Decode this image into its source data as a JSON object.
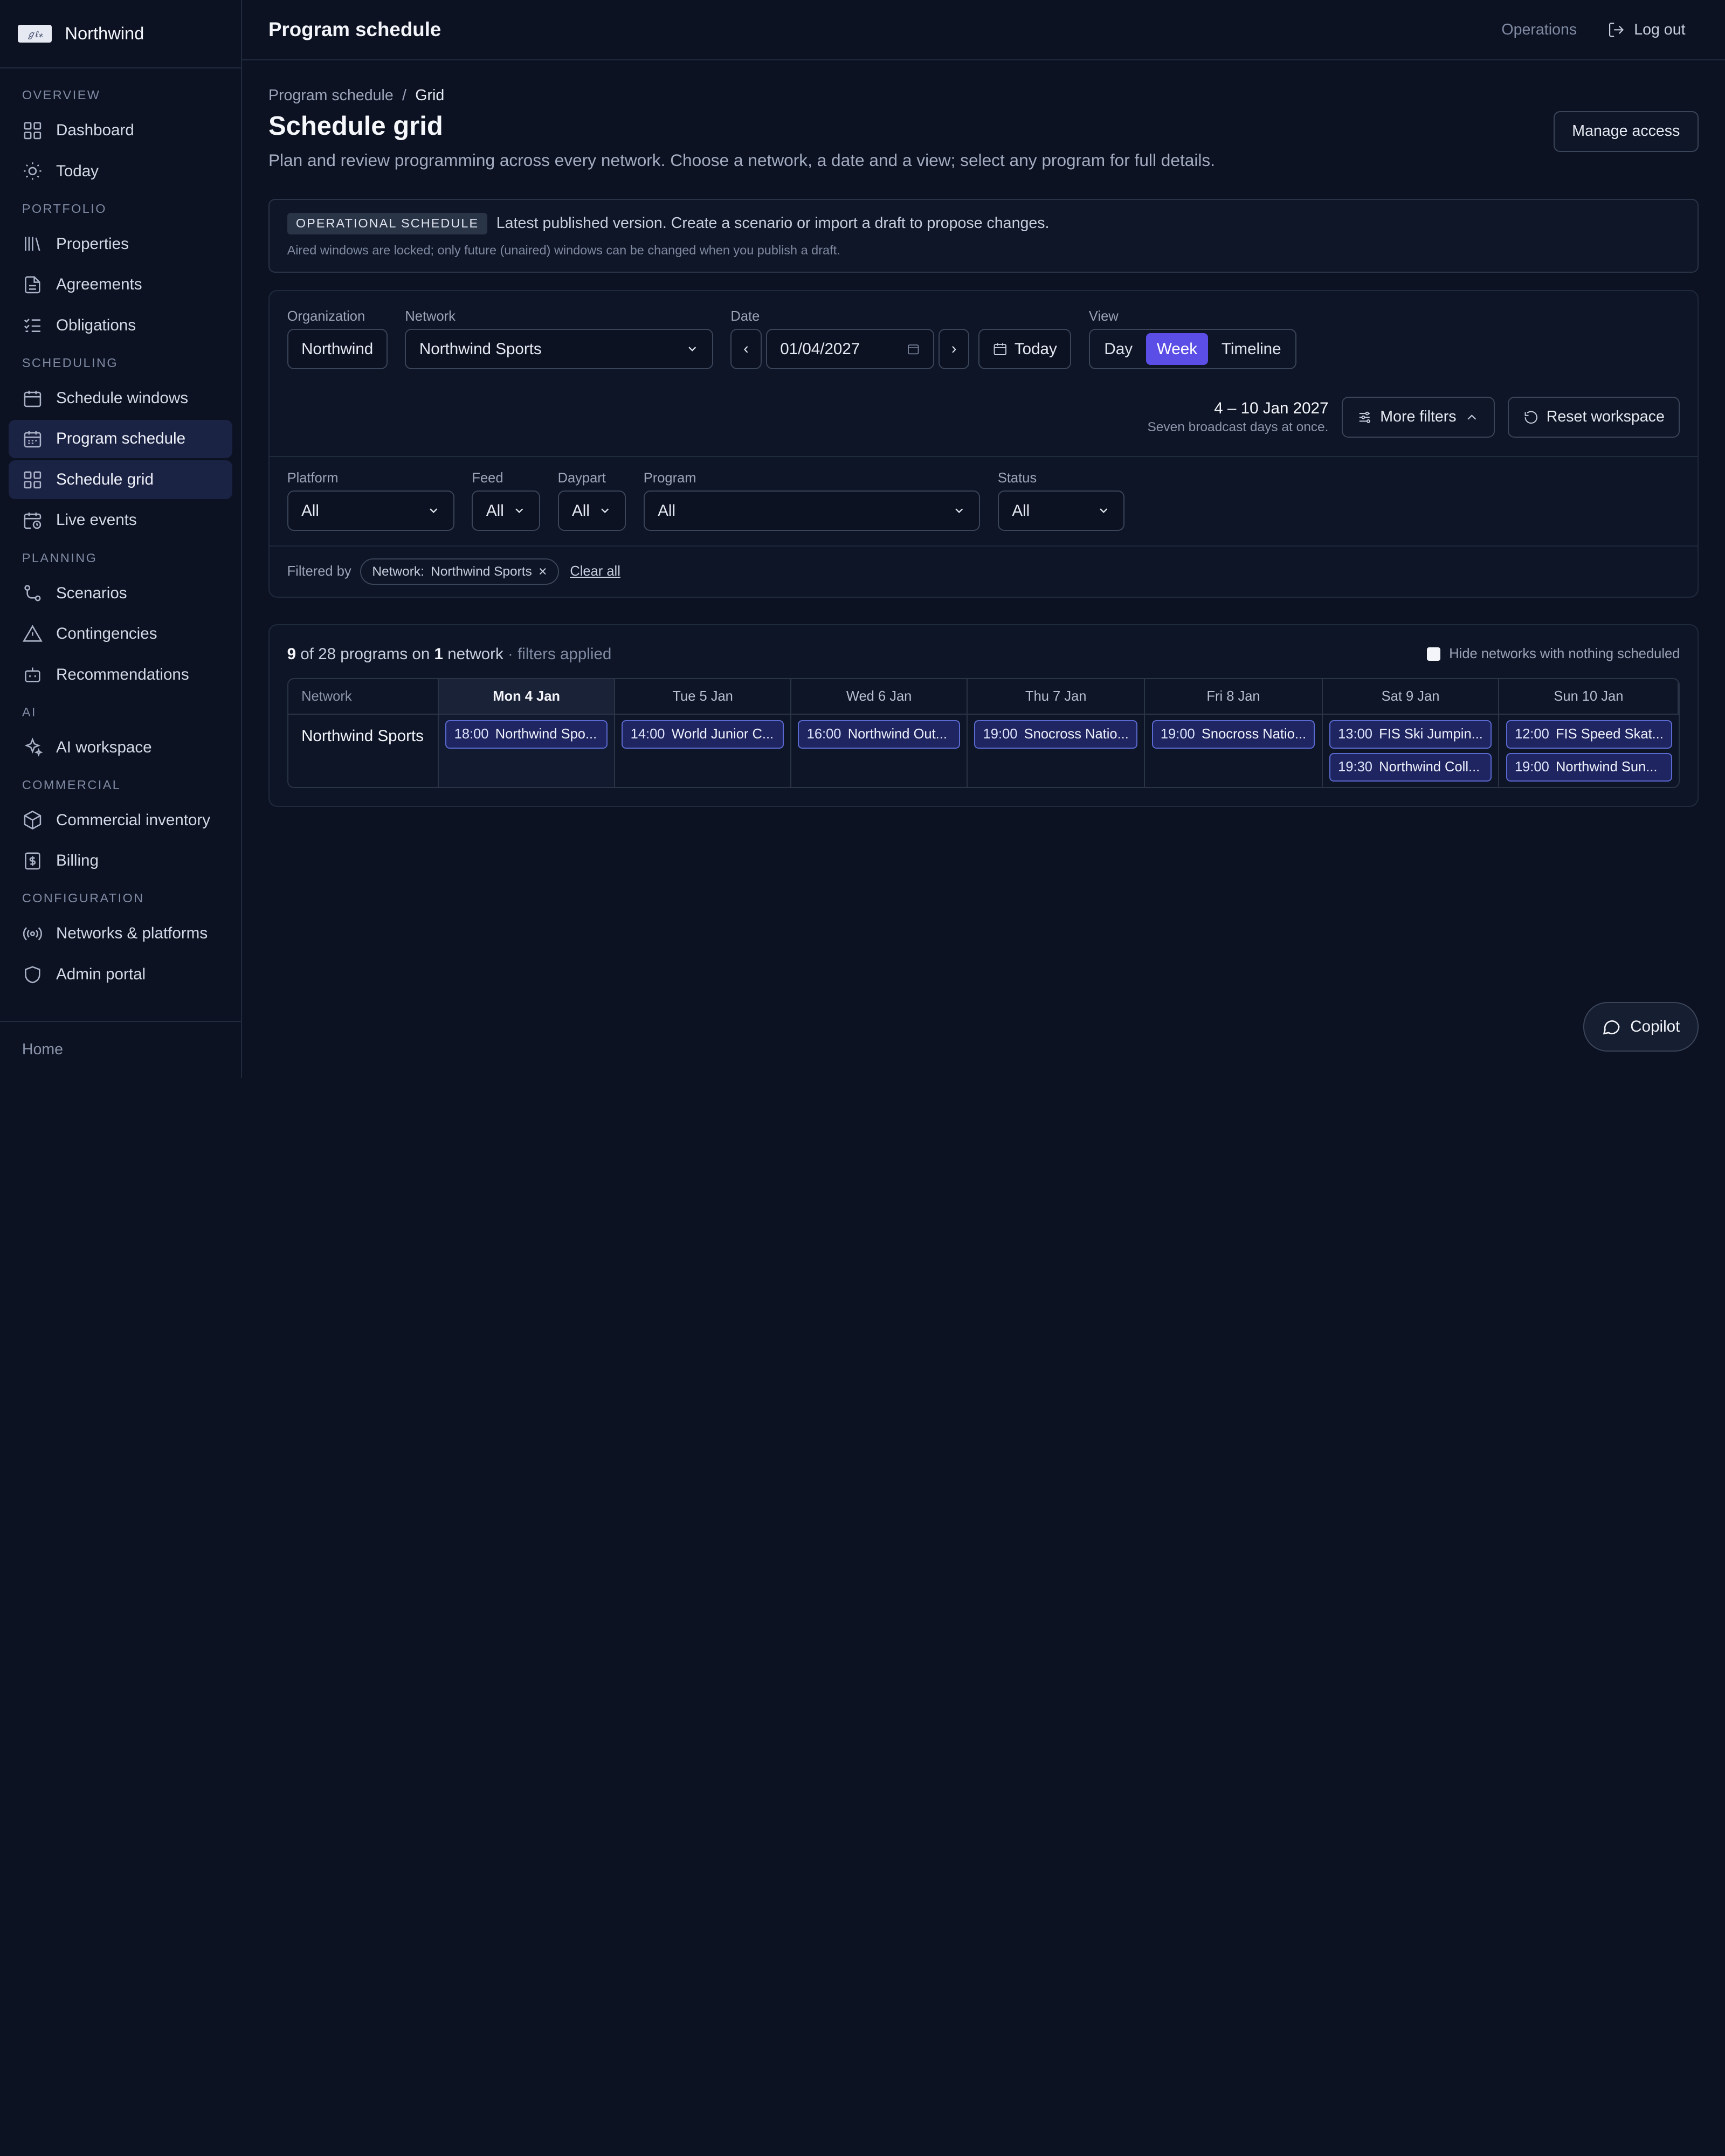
{
  "brand": {
    "name": "Northwind",
    "logo_text": "ℊℓ⁎"
  },
  "sidebar": {
    "sections": [
      {
        "title": "OVERVIEW",
        "items": [
          {
            "label": "Dashboard",
            "icon": "grid-icon"
          },
          {
            "label": "Today",
            "icon": "sun-icon"
          }
        ]
      },
      {
        "title": "PORTFOLIO",
        "items": [
          {
            "label": "Properties",
            "icon": "library-icon"
          },
          {
            "label": "Agreements",
            "icon": "file-icon"
          },
          {
            "label": "Obligations",
            "icon": "checklist-icon"
          }
        ]
      },
      {
        "title": "SCHEDULING",
        "items": [
          {
            "label": "Schedule windows",
            "icon": "calendar-icon"
          },
          {
            "label": "Program schedule",
            "icon": "calendar-grid-icon",
            "active": true
          },
          {
            "label": "Schedule grid",
            "icon": "grid-icon",
            "active": true
          },
          {
            "label": "Live events",
            "icon": "calendar-clock-icon"
          }
        ]
      },
      {
        "title": "PLANNING",
        "items": [
          {
            "label": "Scenarios",
            "icon": "branch-icon"
          },
          {
            "label": "Contingencies",
            "icon": "warning-icon"
          },
          {
            "label": "Recommendations",
            "icon": "bot-icon"
          }
        ]
      },
      {
        "title": "AI",
        "items": [
          {
            "label": "AI workspace",
            "icon": "sparkles-icon"
          }
        ]
      },
      {
        "title": "COMMERCIAL",
        "items": [
          {
            "label": "Commercial inventory",
            "icon": "box-icon"
          },
          {
            "label": "Billing",
            "icon": "dollar-icon"
          }
        ]
      },
      {
        "title": "CONFIGURATION",
        "items": [
          {
            "label": "Networks & platforms",
            "icon": "broadcast-icon"
          },
          {
            "label": "Admin portal",
            "icon": "shield-icon"
          }
        ]
      }
    ],
    "footer": "Home"
  },
  "topbar": {
    "title": "Program schedule",
    "context": "Operations",
    "logout": "Log out"
  },
  "breadcrumb": {
    "parent": "Program schedule",
    "sep": "/",
    "current": "Grid"
  },
  "page": {
    "title": "Schedule grid",
    "description": "Plan and review programming across every network. Choose a network, a date and a view; select any program for full details.",
    "manage_access": "Manage access"
  },
  "banner": {
    "badge": "OPERATIONAL SCHEDULE",
    "text": "Latest published version. Create a scenario or import a draft to propose changes.",
    "sub": "Aired windows are locked; only future (unaired) windows can be changed when you publish a draft."
  },
  "filters": {
    "organization": {
      "label": "Organization",
      "value": "Northwind"
    },
    "network": {
      "label": "Network",
      "value": "Northwind Sports"
    },
    "date": {
      "label": "Date",
      "value": "01/04/2027",
      "prev": "‹",
      "next": "›",
      "today": "Today"
    },
    "view": {
      "label": "View",
      "options": [
        "Day",
        "Week",
        "Timeline"
      ],
      "selected": "Week"
    },
    "range": {
      "main": "4 – 10 Jan 2027",
      "sub": "Seven broadcast days at once."
    },
    "more_filters": "More filters",
    "reset": "Reset workspace",
    "platform": {
      "label": "Platform",
      "value": "All"
    },
    "feed": {
      "label": "Feed",
      "value": "All"
    },
    "daypart": {
      "label": "Daypart",
      "value": "All"
    },
    "program": {
      "label": "Program",
      "value": "All"
    },
    "status": {
      "label": "Status",
      "value": "All"
    },
    "filtered_by": "Filtered by",
    "chip": {
      "key": "Network:",
      "value": "Northwind Sports",
      "remove": "×"
    },
    "clear_all": "Clear all"
  },
  "results": {
    "count": "9",
    "of_text": "of 28 programs on",
    "networks": "1",
    "network_word": "network",
    "applied": "· filters applied",
    "hide_toggle": "Hide networks with nothing scheduled"
  },
  "grid": {
    "network_header": "Network",
    "days": [
      "Mon 4 Jan",
      "Tue 5 Jan",
      "Wed 6 Jan",
      "Thu 7 Jan",
      "Fri 8 Jan",
      "Sat 9 Jan",
      "Sun 10 Jan"
    ],
    "today_index": 0,
    "rows": [
      {
        "network": "Northwind Sports",
        "cells": [
          [
            {
              "time": "18:00",
              "name": "Northwind Spo..."
            }
          ],
          [
            {
              "time": "14:00",
              "name": "World Junior C..."
            }
          ],
          [
            {
              "time": "16:00",
              "name": "Northwind Out..."
            }
          ],
          [
            {
              "time": "19:00",
              "name": "Snocross Natio..."
            }
          ],
          [
            {
              "time": "19:00",
              "name": "Snocross Natio..."
            }
          ],
          [
            {
              "time": "13:00",
              "name": "FIS Ski Jumpin..."
            },
            {
              "time": "19:30",
              "name": "Northwind Coll..."
            }
          ],
          [
            {
              "time": "12:00",
              "name": "FIS Speed Skat..."
            },
            {
              "time": "19:00",
              "name": "Northwind Sun..."
            }
          ]
        ]
      }
    ]
  },
  "copilot": "Copilot"
}
